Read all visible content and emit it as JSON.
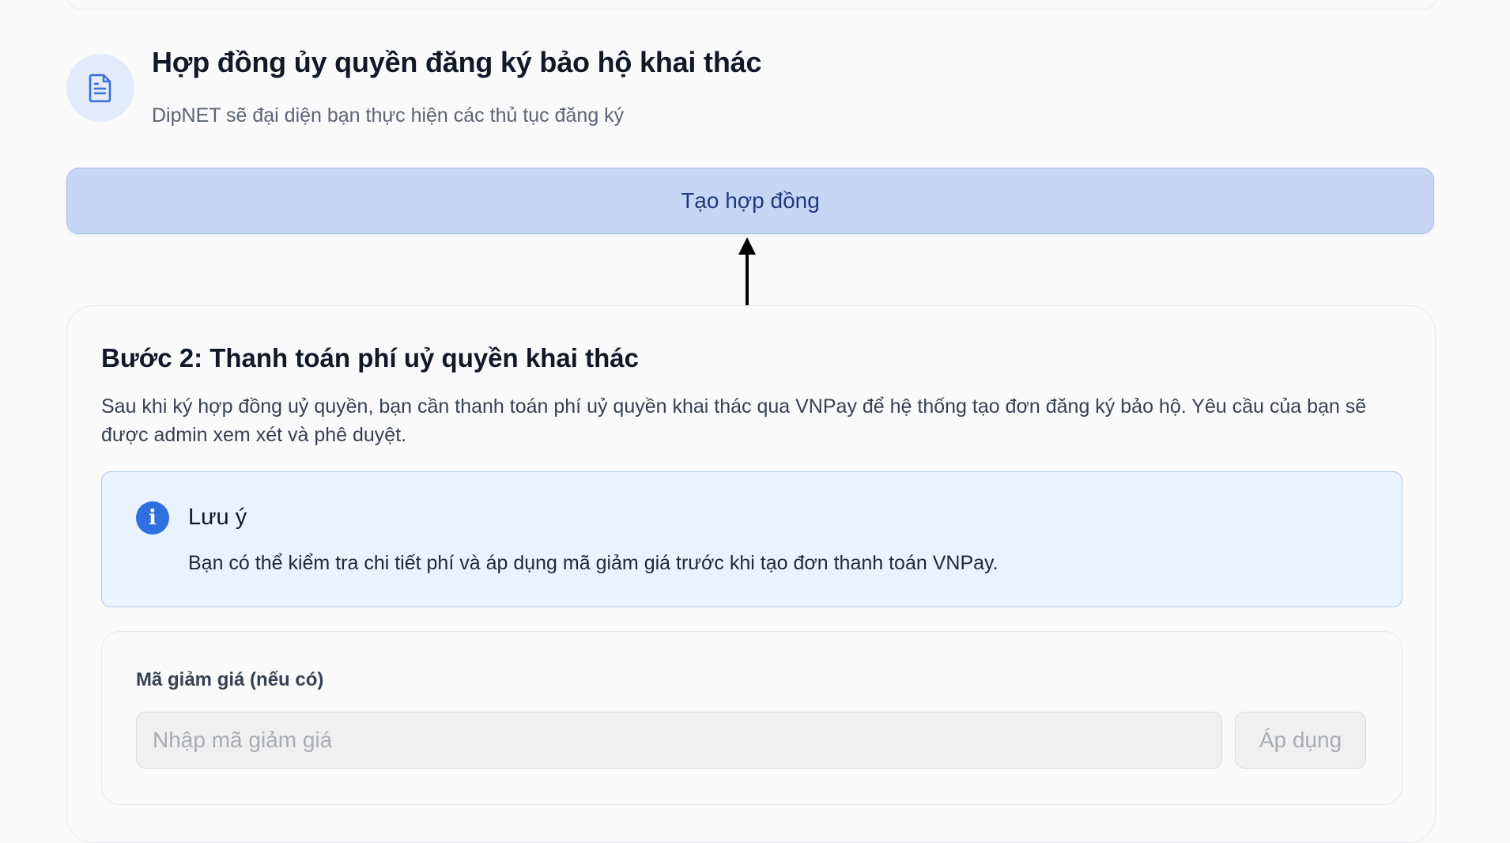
{
  "contract": {
    "title": "Hợp đồng ủy quyền đăng ký bảo hộ khai thác",
    "subtitle": "DipNET sẽ đại diện bạn thực hiện các thủ tục đăng ký",
    "icon": "document-icon",
    "create_button_label": "Tạo hợp đồng"
  },
  "step2": {
    "title": "Bước 2: Thanh toán phí uỷ quyền khai thác",
    "description": "Sau khi ký hợp đồng uỷ quyền, bạn cần thanh toán phí uỷ quyền khai thác qua VNPay để hệ thống tạo đơn đăng ký bảo hộ. Yêu cầu của bạn sẽ được admin xem xét và phê duyệt.",
    "note": {
      "icon": "info-icon",
      "title": "Lưu ý",
      "text": "Bạn có thể kiểm tra chi tiết phí và áp dụng mã giảm giá trước khi tạo đơn thanh toán VNPay."
    },
    "discount": {
      "label": "Mã giảm giá (nếu có)",
      "placeholder": "Nhập mã giảm giá",
      "value": "",
      "apply_label": "Áp dụng"
    }
  },
  "colors": {
    "primary_button_bg": "#c8d6f6",
    "primary_button_text": "#1e3a7a",
    "info_accent": "#2f6fe0",
    "note_bg": "#e9f3fd"
  }
}
